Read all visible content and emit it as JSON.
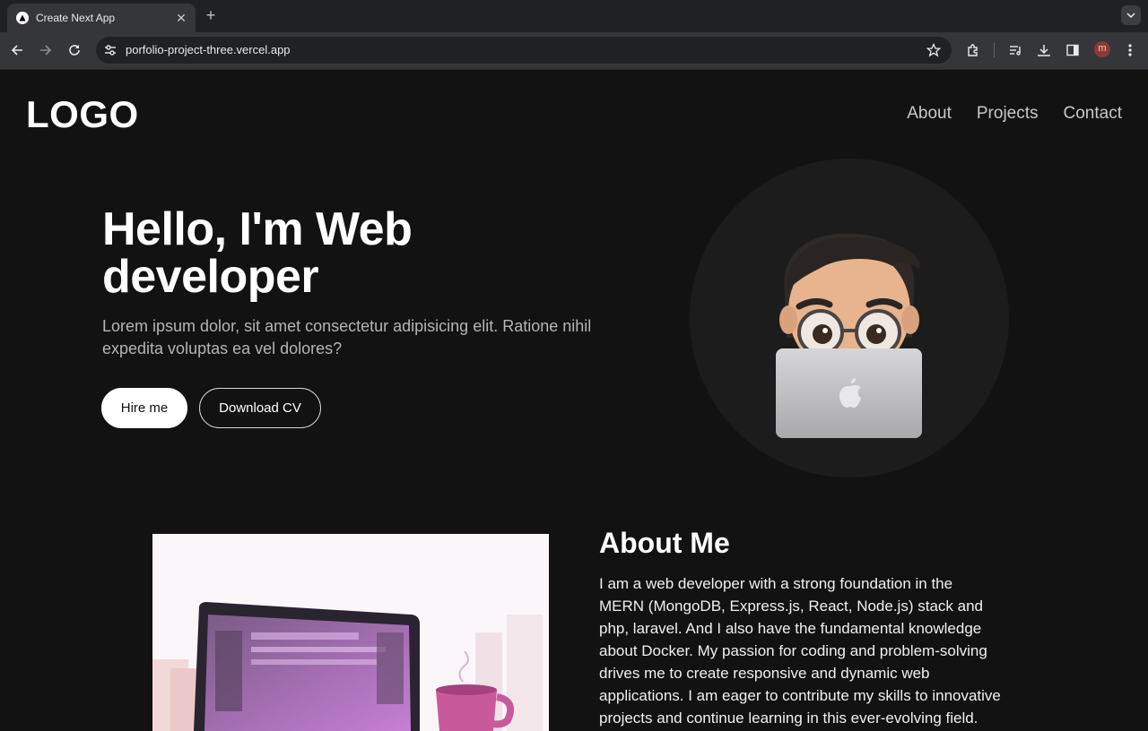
{
  "browser": {
    "tab_title": "Create Next App",
    "url": "porfolio-project-three.vercel.app",
    "profile_initial": "m"
  },
  "site": {
    "logo": "LOGO",
    "nav": [
      "About",
      "Projects",
      "Contact"
    ]
  },
  "hero": {
    "title": "Hello, I'm Web developer",
    "subtitle": "Lorem ipsum dolor, sit amet consectetur adipisicing elit. Ratione nihil expedita voluptas ea vel dolores?",
    "hire_label": "Hire me",
    "cv_label": "Download CV"
  },
  "about": {
    "title": "About Me",
    "text": "I am a web developer with a strong foundation in the MERN (MongoDB, Express.js, React, Node.js) stack and php, laravel. And I also have the fundamental knowledge about Docker. My passion for coding and problem-solving drives me to create responsive and dynamic web applications. I am eager to contribute my skills to innovative projects and continue learning in this ever-evolving field."
  },
  "colors": {
    "page_bg": "#121212",
    "avatar_circle": "#1c1c1c",
    "nav_text": "#c8c8c8"
  },
  "icons": [
    "back-icon",
    "forward-icon",
    "reload-icon",
    "tune-icon",
    "star-icon",
    "extensions-icon",
    "media-icon",
    "download-icon",
    "sidepanel-icon",
    "menu-icon"
  ]
}
